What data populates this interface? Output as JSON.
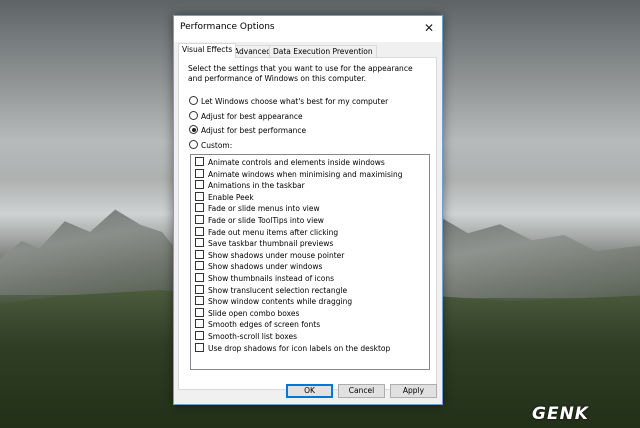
{
  "dialog": {
    "title": "Performance Options",
    "close_glyph": "✕"
  },
  "tabs": [
    {
      "label": "Visual Effects",
      "active": true
    },
    {
      "label": "Advanced",
      "active": false
    },
    {
      "label": "Data Execution Prevention",
      "active": false
    }
  ],
  "description": "Select the settings that you want to use for the appearance and performance of Windows on this computer.",
  "radios": [
    {
      "label": "Let Windows choose what's best for my computer",
      "selected": false
    },
    {
      "label": "Adjust for best appearance",
      "selected": false
    },
    {
      "label": "Adjust for best performance",
      "selected": true
    },
    {
      "label": "Custom:",
      "selected": false
    }
  ],
  "effects": [
    {
      "label": "Animate controls and elements inside windows",
      "checked": false
    },
    {
      "label": "Animate windows when minimising and maximising",
      "checked": false
    },
    {
      "label": "Animations in the taskbar",
      "checked": false
    },
    {
      "label": "Enable Peek",
      "checked": false
    },
    {
      "label": "Fade or slide menus into view",
      "checked": false
    },
    {
      "label": "Fade or slide ToolTips into view",
      "checked": false
    },
    {
      "label": "Fade out menu items after clicking",
      "checked": false
    },
    {
      "label": "Save taskbar thumbnail previews",
      "checked": false
    },
    {
      "label": "Show shadows under mouse pointer",
      "checked": false
    },
    {
      "label": "Show shadows under windows",
      "checked": false
    },
    {
      "label": "Show thumbnails instead of icons",
      "checked": false
    },
    {
      "label": "Show translucent selection rectangle",
      "checked": false
    },
    {
      "label": "Show window contents while dragging",
      "checked": false
    },
    {
      "label": "Slide open combo boxes",
      "checked": false
    },
    {
      "label": "Smooth edges of screen fonts",
      "checked": false
    },
    {
      "label": "Smooth-scroll list boxes",
      "checked": false
    },
    {
      "label": "Use drop shadows for icon labels on the desktop",
      "checked": false
    }
  ],
  "buttons": {
    "ok": "OK",
    "cancel": "Cancel",
    "apply": "Apply"
  },
  "watermark": "GENK",
  "colors": {
    "accent": "#0078d7",
    "dialog_border": "#6f9fd6"
  }
}
